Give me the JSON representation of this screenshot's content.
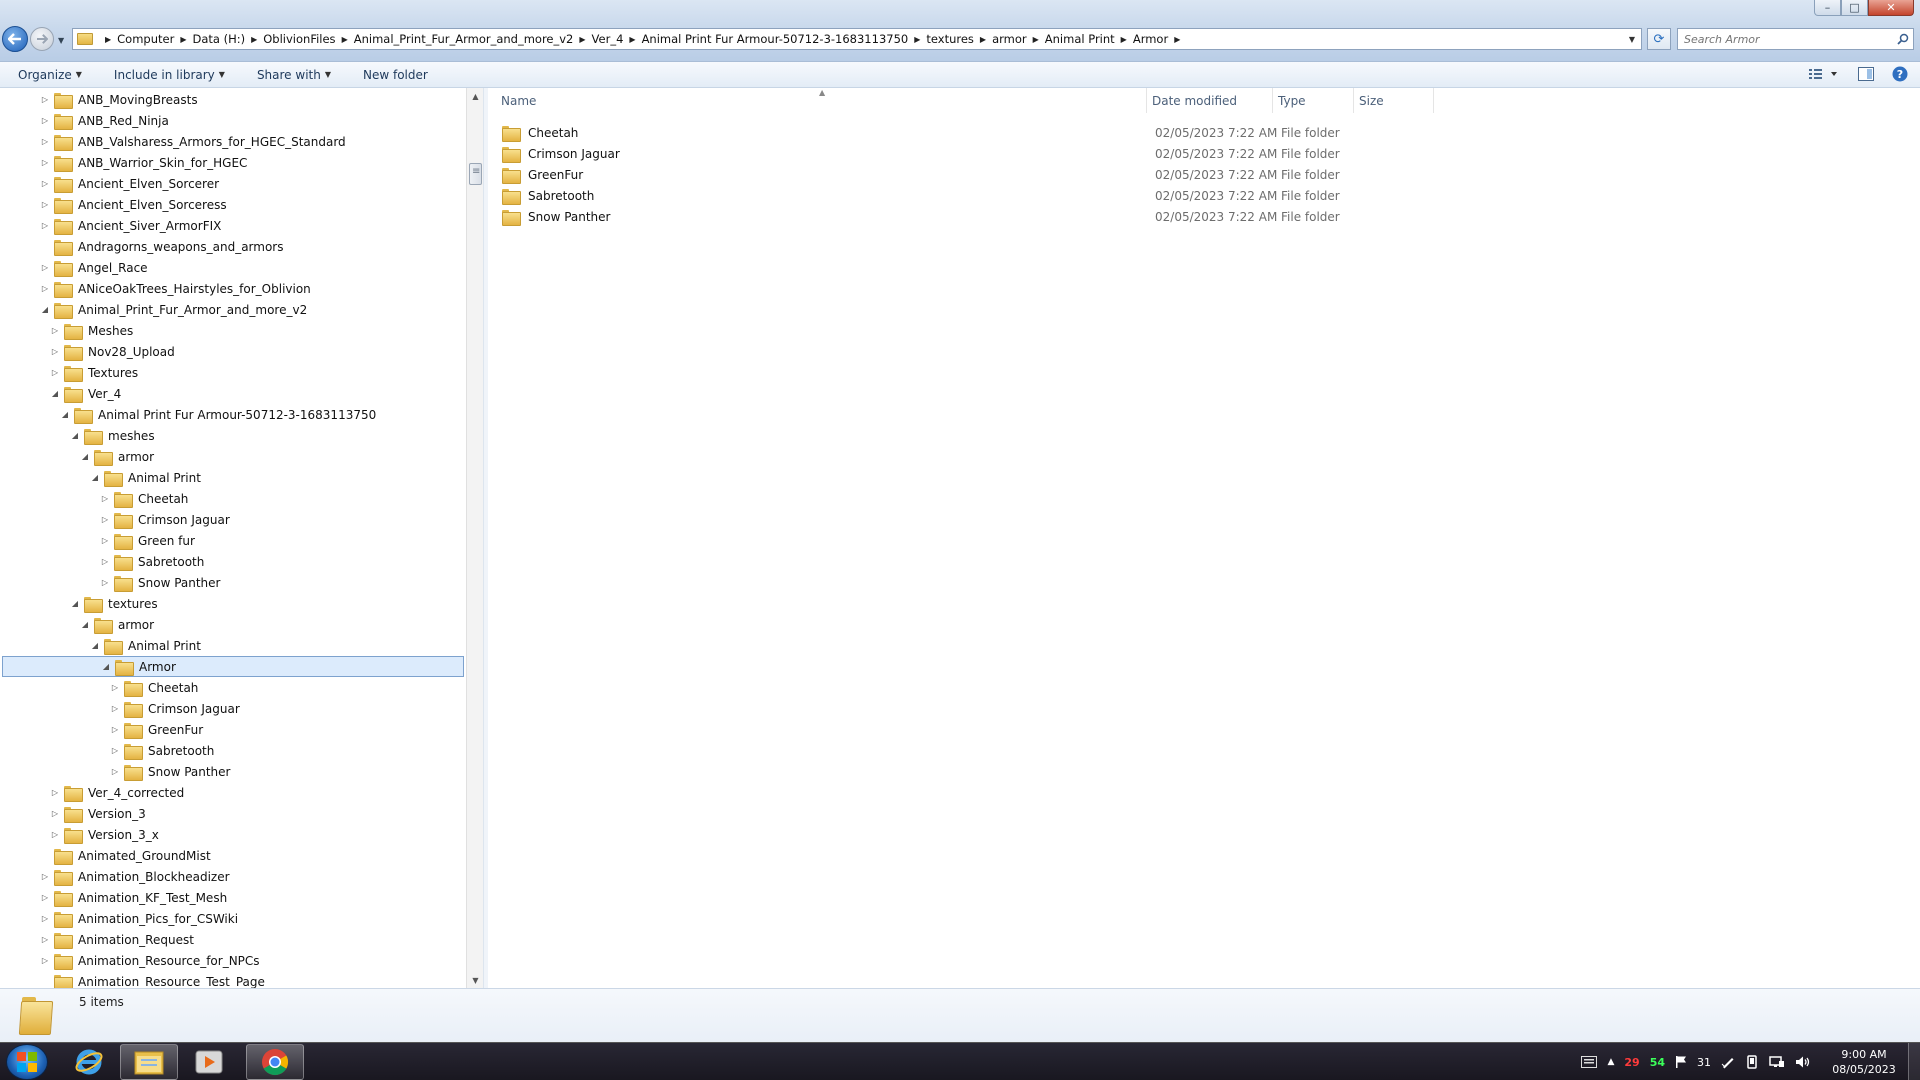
{
  "window_controls": {
    "minimize": "–",
    "maximize": "□",
    "close": "✕"
  },
  "address": {
    "crumbs": [
      "Computer",
      "Data (H:)",
      "OblivionFiles",
      "Animal_Print_Fur_Armor_and_more_v2",
      "Ver_4",
      "Animal Print Fur Armour-50712-3-1683113750",
      "textures",
      "armor",
      "Animal Print",
      "Armor"
    ]
  },
  "search": {
    "placeholder": "Search Armor"
  },
  "toolbar": {
    "organize": "Organize",
    "include_in_library": "Include in library",
    "share_with": "Share with",
    "new_folder": "New folder"
  },
  "tree": [
    {
      "label": "ANB_MovingBreasts",
      "depth": 0,
      "state": "collapsed"
    },
    {
      "label": "ANB_Red_Ninja",
      "depth": 0,
      "state": "collapsed"
    },
    {
      "label": "ANB_Valsharess_Armors_for_HGEC_Standard",
      "depth": 0,
      "state": "collapsed"
    },
    {
      "label": "ANB_Warrior_Skin_for_HGEC",
      "depth": 0,
      "state": "collapsed"
    },
    {
      "label": "Ancient_Elven_Sorcerer",
      "depth": 0,
      "state": "collapsed"
    },
    {
      "label": "Ancient_Elven_Sorceress",
      "depth": 0,
      "state": "collapsed"
    },
    {
      "label": "Ancient_Siver_ArmorFIX",
      "depth": 0,
      "state": "collapsed"
    },
    {
      "label": "Andragorns_weapons_and_armors",
      "depth": 0,
      "state": "none"
    },
    {
      "label": "Angel_Race",
      "depth": 0,
      "state": "collapsed"
    },
    {
      "label": "ANiceOakTrees_Hairstyles_for_Oblivion",
      "depth": 0,
      "state": "collapsed"
    },
    {
      "label": "Animal_Print_Fur_Armor_and_more_v2",
      "depth": 0,
      "state": "expanded"
    },
    {
      "label": "Meshes",
      "depth": 1,
      "state": "collapsed"
    },
    {
      "label": "Nov28_Upload",
      "depth": 1,
      "state": "collapsed"
    },
    {
      "label": "Textures",
      "depth": 1,
      "state": "collapsed"
    },
    {
      "label": "Ver_4",
      "depth": 1,
      "state": "expanded"
    },
    {
      "label": "Animal Print Fur Armour-50712-3-1683113750",
      "depth": 2,
      "state": "expanded"
    },
    {
      "label": "meshes",
      "depth": 3,
      "state": "expanded"
    },
    {
      "label": "armor",
      "depth": 4,
      "state": "expanded"
    },
    {
      "label": "Animal Print",
      "depth": 5,
      "state": "expanded"
    },
    {
      "label": "Cheetah",
      "depth": 6,
      "state": "collapsed"
    },
    {
      "label": "Crimson Jaguar",
      "depth": 6,
      "state": "collapsed"
    },
    {
      "label": "Green fur",
      "depth": 6,
      "state": "collapsed"
    },
    {
      "label": "Sabretooth",
      "depth": 6,
      "state": "collapsed"
    },
    {
      "label": "Snow Panther",
      "depth": 6,
      "state": "collapsed"
    },
    {
      "label": "textures",
      "depth": 3,
      "state": "expanded"
    },
    {
      "label": "armor",
      "depth": 4,
      "state": "expanded"
    },
    {
      "label": "Animal Print",
      "depth": 5,
      "state": "expanded"
    },
    {
      "label": "Armor",
      "depth": 6,
      "state": "expanded",
      "selected": true
    },
    {
      "label": "Cheetah",
      "depth": 7,
      "state": "collapsed"
    },
    {
      "label": "Crimson Jaguar",
      "depth": 7,
      "state": "collapsed"
    },
    {
      "label": "GreenFur",
      "depth": 7,
      "state": "collapsed"
    },
    {
      "label": "Sabretooth",
      "depth": 7,
      "state": "collapsed"
    },
    {
      "label": "Snow Panther",
      "depth": 7,
      "state": "collapsed"
    },
    {
      "label": "Ver_4_corrected",
      "depth": 1,
      "state": "collapsed"
    },
    {
      "label": "Version_3",
      "depth": 1,
      "state": "collapsed"
    },
    {
      "label": "Version_3_x",
      "depth": 1,
      "state": "collapsed"
    },
    {
      "label": "Animated_GroundMist",
      "depth": 0,
      "state": "none"
    },
    {
      "label": "Animation_Blockheadizer",
      "depth": 0,
      "state": "collapsed"
    },
    {
      "label": "Animation_KF_Test_Mesh",
      "depth": 0,
      "state": "collapsed"
    },
    {
      "label": "Animation_Pics_for_CSWiki",
      "depth": 0,
      "state": "collapsed"
    },
    {
      "label": "Animation_Request",
      "depth": 0,
      "state": "collapsed"
    },
    {
      "label": "Animation_Resource_for_NPCs",
      "depth": 0,
      "state": "collapsed"
    },
    {
      "label": "Animation_Resource_Test_Page",
      "depth": 0,
      "state": "none"
    }
  ],
  "columns": {
    "name": "Name",
    "date_modified": "Date modified",
    "type": "Type",
    "size": "Size"
  },
  "files": [
    {
      "name": "Cheetah",
      "date": "02/05/2023 7:22 AM",
      "type": "File folder",
      "size": ""
    },
    {
      "name": "Crimson Jaguar",
      "date": "02/05/2023 7:22 AM",
      "type": "File folder",
      "size": ""
    },
    {
      "name": "GreenFur",
      "date": "02/05/2023 7:22 AM",
      "type": "File folder",
      "size": ""
    },
    {
      "name": "Sabretooth",
      "date": "02/05/2023 7:22 AM",
      "type": "File folder",
      "size": ""
    },
    {
      "name": "Snow Panther",
      "date": "02/05/2023 7:22 AM",
      "type": "File folder",
      "size": ""
    }
  ],
  "details": {
    "item_count": "5 items"
  },
  "taskbar": {
    "apps": [
      "internet-explorer",
      "windows-explorer",
      "media-player",
      "chrome"
    ],
    "tray": {
      "red_value": "29",
      "green_value": "54",
      "calendar_day": "31"
    },
    "clock": {
      "time": "9:00 AM",
      "date": "08/05/2023"
    }
  }
}
